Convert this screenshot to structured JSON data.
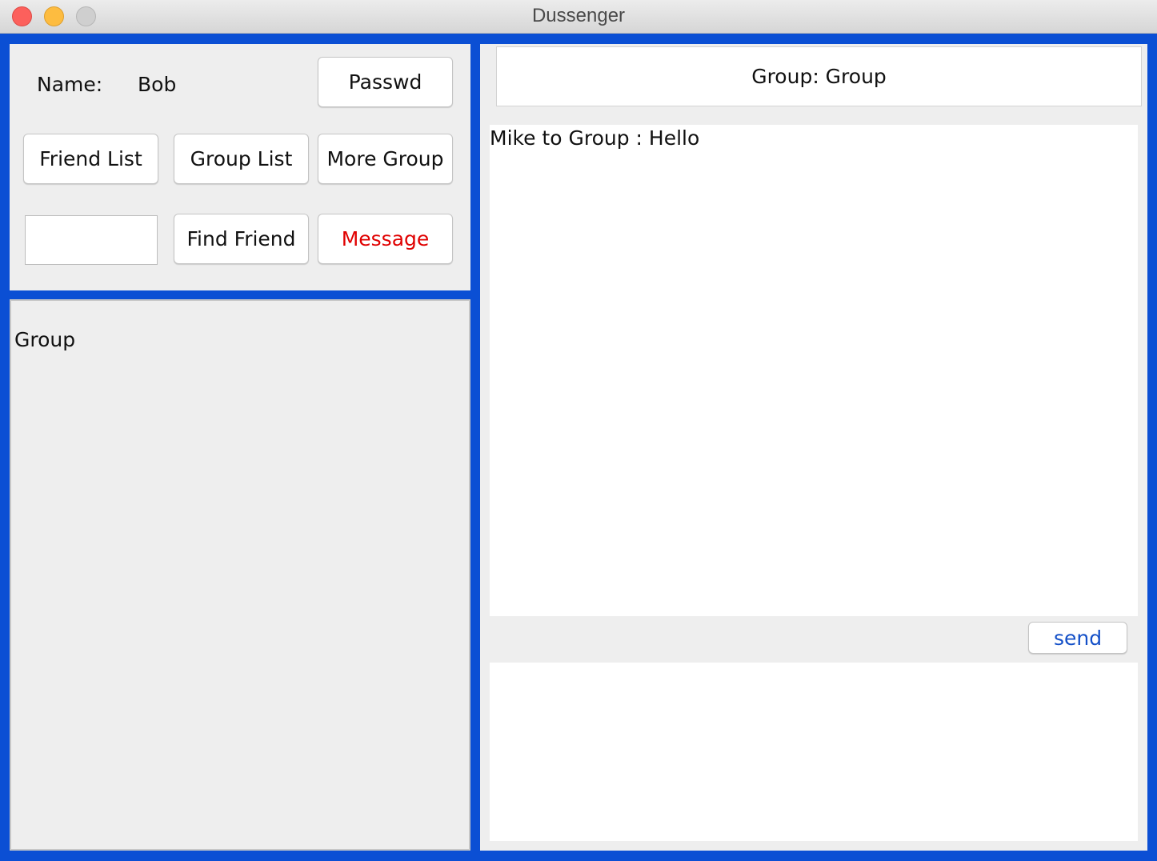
{
  "window": {
    "title": "Dussenger"
  },
  "profile": {
    "name_label": "Name:",
    "name_value": "Bob",
    "passwd_button": "Passwd"
  },
  "toolbar": {
    "friend_list_button": "Friend List",
    "group_list_button": "Group List",
    "more_group_button": "More Group",
    "find_friend_input_value": "",
    "find_friend_button": "Find Friend",
    "message_button": "Message"
  },
  "list": {
    "items": [
      "Group"
    ]
  },
  "chat": {
    "header": "Group: Group",
    "messages": [
      "Mike to Group : Hello"
    ],
    "send_button": "send",
    "compose_value": ""
  },
  "colors": {
    "frame": "#0b4fd4",
    "message_button_text": "#e00000",
    "send_button_text": "#1450c8"
  }
}
